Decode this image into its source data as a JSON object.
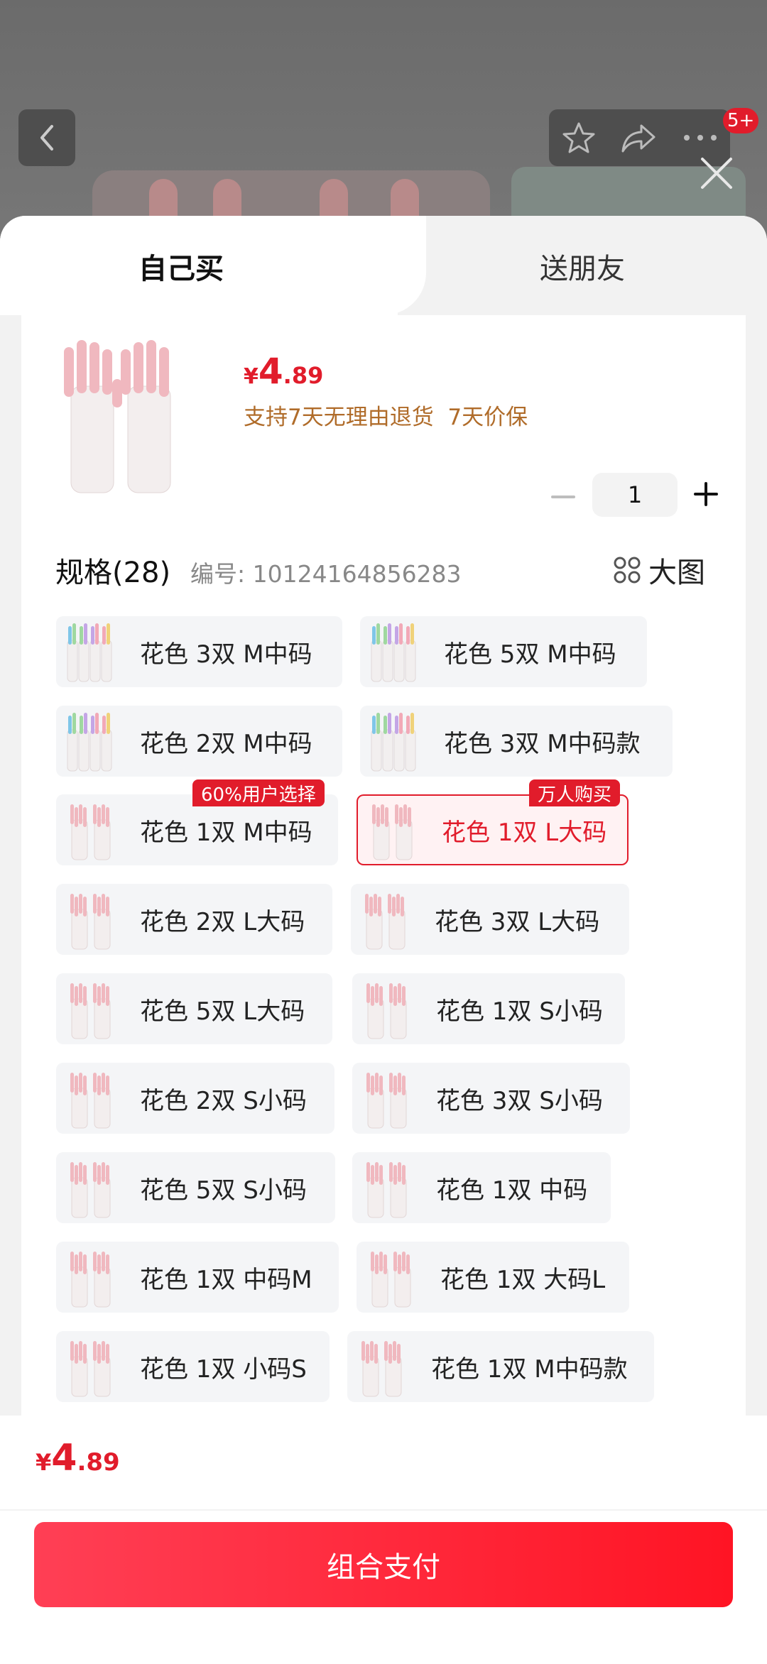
{
  "nav": {
    "badge": "5+"
  },
  "tabs": {
    "self": "自己买",
    "friend": "送朋友"
  },
  "product": {
    "price_currency": "¥",
    "price_integer": "4",
    "price_decimal": ".89",
    "guarantee": "支持7天无理由退货  7天价保",
    "quantity": "1"
  },
  "spec": {
    "title": "规格(28)",
    "code": "编号: 10124164856283",
    "big_picture": "大图"
  },
  "options": [
    {
      "label": "花色 3双 M中码",
      "thumb": "multi"
    },
    {
      "label": "花色 5双 M中码",
      "thumb": "multi"
    },
    {
      "label": "花色 2双 M中码",
      "thumb": "multi"
    },
    {
      "label": "花色 3双 M中码款",
      "thumb": "multi"
    },
    {
      "label": "花色 1双 M中码",
      "thumb": "pink"
    },
    {
      "label": "花色 1双 L大码",
      "thumb": "pink"
    },
    {
      "label": "花色 2双 L大码",
      "thumb": "pink"
    },
    {
      "label": "花色 3双 L大码",
      "thumb": "pink"
    },
    {
      "label": "花色 5双 L大码",
      "thumb": "pink"
    },
    {
      "label": "花色 1双 S小码",
      "thumb": "pink"
    },
    {
      "label": "花色 2双 S小码",
      "thumb": "pink"
    },
    {
      "label": "花色 3双 S小码",
      "thumb": "pink"
    },
    {
      "label": "花色 5双 S小码",
      "thumb": "pink"
    },
    {
      "label": "花色 1双 中码",
      "thumb": "pink"
    },
    {
      "label": "花色 1双 中码M",
      "thumb": "pink"
    },
    {
      "label": "花色 1双 大码L",
      "thumb": "pink"
    },
    {
      "label": "花色 1双 小码S",
      "thumb": "pink"
    },
    {
      "label": "花色 1双 M中码款",
      "thumb": "pink"
    }
  ],
  "tags": {
    "popular": "60%用户选择",
    "hot": "万人购买"
  },
  "footer": {
    "price_currency": "¥",
    "price_integer": "4",
    "price_decimal": ".89",
    "pay_button": "组合支付"
  },
  "colors": {
    "accent": "#e11c2b",
    "guarantee": "#b06c2a"
  }
}
